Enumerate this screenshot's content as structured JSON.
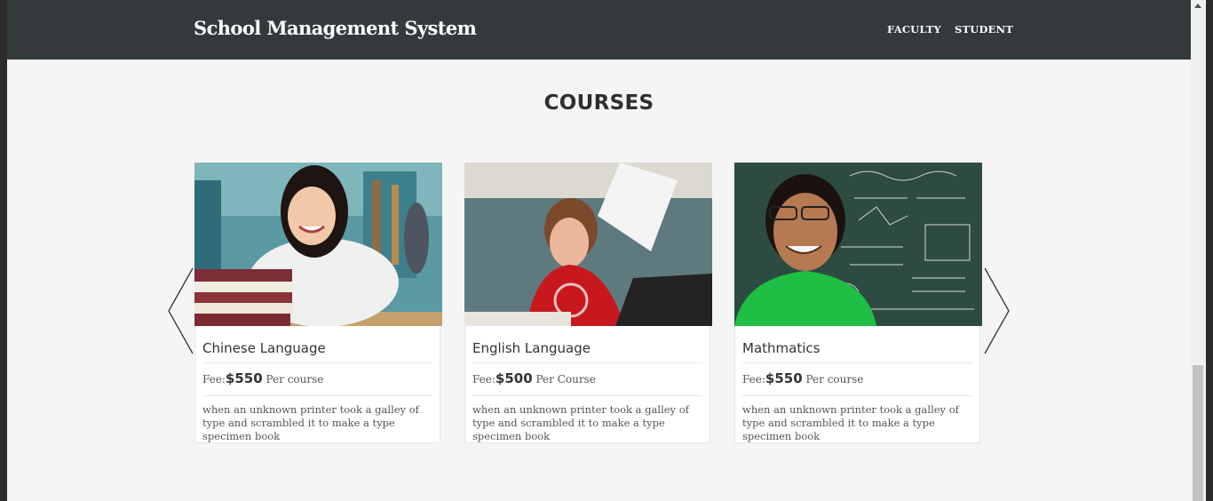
{
  "navbar": {
    "brand": "School Management System",
    "links": [
      "FACULTY",
      "STUDENT"
    ]
  },
  "section": {
    "title": "COURSES"
  },
  "courses": [
    {
      "title": "Chinese Language",
      "fee_label": "Fee:",
      "fee_amount": "$550",
      "fee_suffix": "Per course",
      "description": "when an unknown printer took a galley of type and scrambled it to make a type specimen book"
    },
    {
      "title": "English Language",
      "fee_label": "Fee:",
      "fee_amount": "$500",
      "fee_suffix": "Per Course",
      "description": "when an unknown printer took a galley of type and scrambled it to make a type specimen book"
    },
    {
      "title": "Mathmatics",
      "fee_label": "Fee:",
      "fee_amount": "$550",
      "fee_suffix": "Per course",
      "description": "when an unknown printer took a galley of type and scrambled it to make a type specimen book"
    }
  ],
  "carousel": {
    "prev_icon": "chevron-left-icon",
    "next_icon": "chevron-right-icon"
  },
  "colors": {
    "navbar_bg": "#343a3c",
    "page_bg": "#f5f5f5",
    "card_bg": "#ffffff"
  }
}
